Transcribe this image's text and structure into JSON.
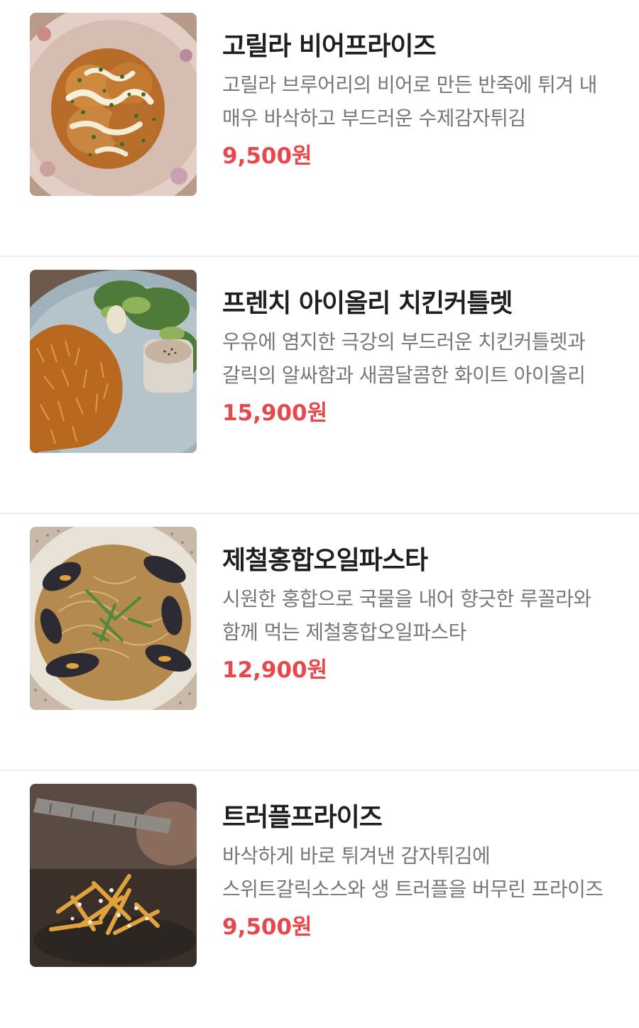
{
  "menu": {
    "items": [
      {
        "name": "고릴라 비어프라이즈",
        "description": "고릴라 브루어리의 비어로 만든 반죽에 튀겨 내 매우 바삭하고 부드러운 수제감자튀김",
        "price": "9,500원",
        "image_icon": "beer-fries-photo"
      },
      {
        "name": "프렌치 아이올리 치킨커틀렛",
        "description": "우유에 염지한 극강의 부드러운 치킨커틀렛과 갈릭의 알싸함과 새콤달콤한 화이트 아이올리",
        "price": "15,900원",
        "image_icon": "chicken-cutlet-photo"
      },
      {
        "name": "제철홍합오일파스타",
        "description": "시원한 홍합으로 국물을 내어 향긋한 루꼴라와 함께 먹는 제철홍합오일파스타",
        "price": "12,900원",
        "image_icon": "mussel-pasta-photo"
      },
      {
        "name": "트러플프라이즈",
        "description": "바삭하게 바로 튀겨낸 감자튀김에 스위트갈릭소스와 생 트러플을 버무린 프라이즈",
        "price": "9,500원",
        "image_icon": "truffle-fries-photo"
      }
    ],
    "colors": {
      "price": "#e6484c",
      "name": "#1f1f1f",
      "description": "#777777",
      "divider": "#ececec"
    }
  }
}
